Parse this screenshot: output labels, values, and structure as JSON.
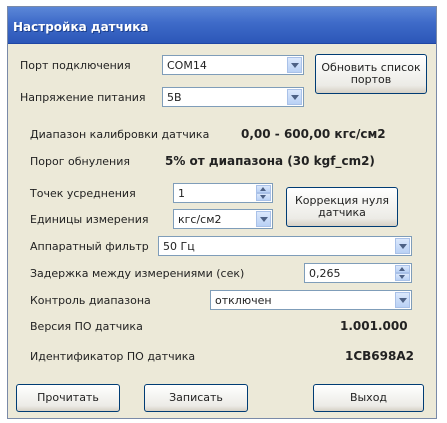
{
  "window": {
    "title": "Настройка датчика"
  },
  "port": {
    "label": "Порт подключения",
    "value": "COM14"
  },
  "refresh_button": "Обновить список портов",
  "voltage": {
    "label": "Напряжение питания",
    "value": "5В"
  },
  "calibration": {
    "label": "Диапазон калибровки датчика",
    "value": "0,00 - 600,00 кгс/см2"
  },
  "zero_threshold": {
    "label": "Порог обнуления",
    "value": "5% от диапазона (30 kgf_cm2)"
  },
  "averaging": {
    "label": "Точек усреднения",
    "value": "1"
  },
  "zero_correction_button": "Коррекция нуля датчика",
  "units": {
    "label": "Единицы измерения",
    "value": "кгс/см2"
  },
  "filter": {
    "label": "Аппаратный фильтр",
    "value": "50 Гц"
  },
  "delay": {
    "label": "Задержка между измерениями (сек)",
    "value": "0,265"
  },
  "range_control": {
    "label": "Контроль диапазона",
    "value": "отключен"
  },
  "firmware_version": {
    "label": "Версия ПО датчика",
    "value": "1.001.000"
  },
  "firmware_id": {
    "label": "Идентификатор ПО датчика",
    "value": "1CB698A2"
  },
  "footer": {
    "read": "Прочитать",
    "write": "Записать",
    "exit": "Выход"
  }
}
